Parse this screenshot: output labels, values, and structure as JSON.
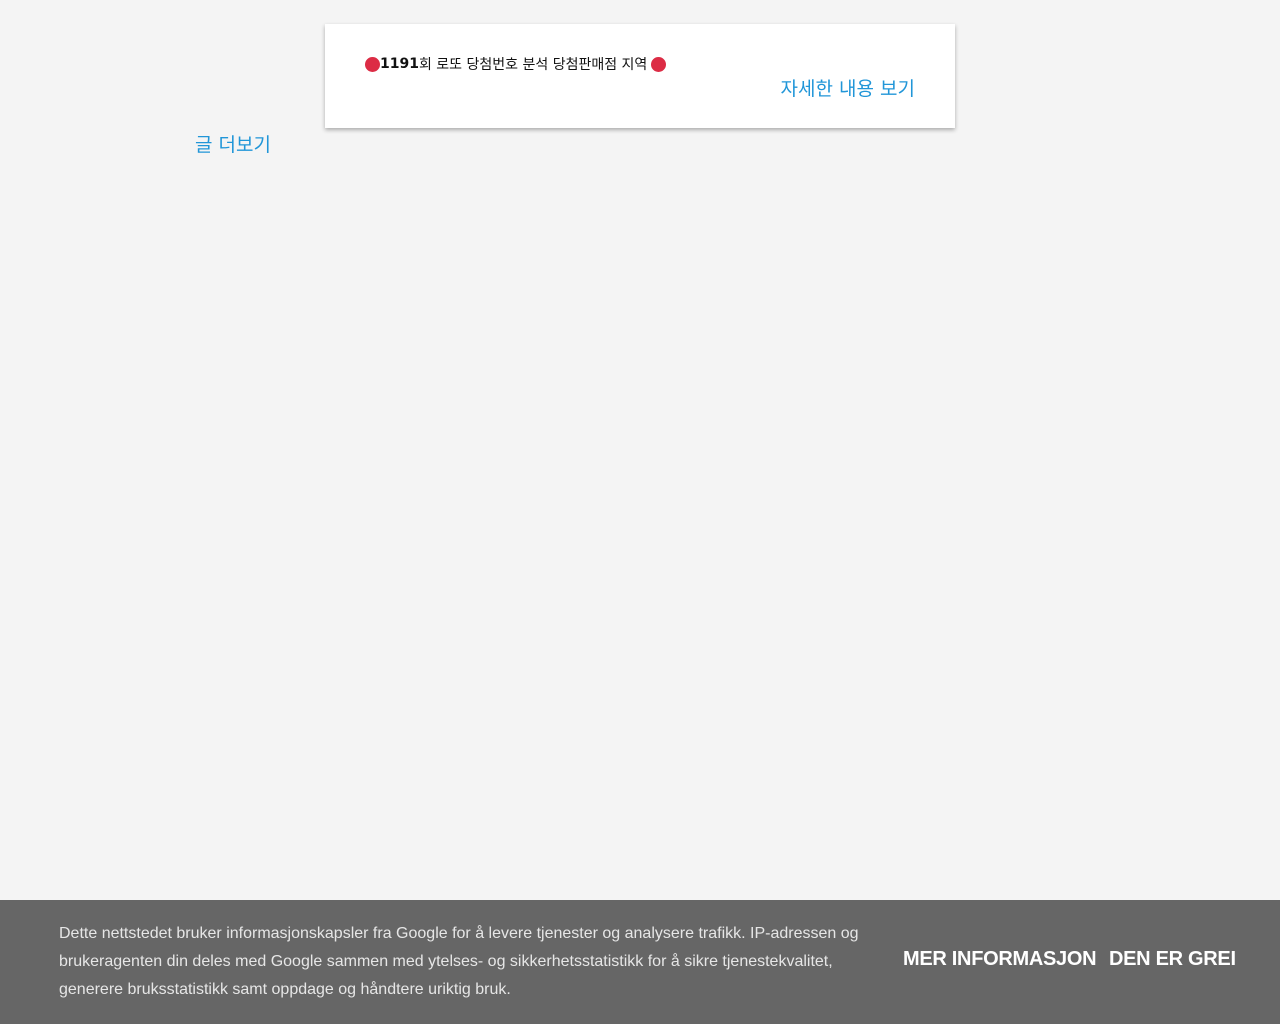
{
  "post": {
    "title_number": "1191",
    "title_rest": "회 로또 당첨번호 분석 당첨판매점 지역",
    "read_more_label": "자세한 내용 보기"
  },
  "pager": {
    "more_posts_label": "글 더보기"
  },
  "cookie_notice": {
    "text": "Dette nettstedet bruker informasjonskapsler fra Google for å levere tjenester og analysere trafikk. IP-adressen og brukeragenten din deles med Google sammen med ytelses- og sikkerhetsstatistikk for å sikre tjenestekvalitet, generere bruksstatistikk samt oppdage og håndtere uriktig bruk.",
    "more_info_label": "MER INFORMASJON",
    "ok_label": "DEN ER GREI"
  },
  "colors": {
    "accent": "#2196d8",
    "dot": "#dc2c45",
    "cookie_bg": "#666666",
    "page_bg": "#f4f4f4"
  },
  "icons": {
    "title_bullet": "red-circle-icon"
  }
}
